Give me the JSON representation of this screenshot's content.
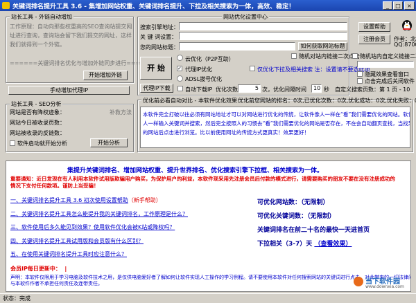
{
  "window": {
    "title": "关键词排名提升工具 3.6 - 集增加网站权重、关键词排名提升、下拉及相关搜索为一体，高效、稳定！"
  },
  "left_group": {
    "label": "站长工具 - 外链自动增加",
    "desc_lines": [
      "工作原理：自动向那些权重高的SEO查询站提交网",
      "址进行查询，查询站会留下我们提交的网址，这样",
      "我们就得到一个外链。"
    ],
    "divider": "======关键词排名优化与增加外链同步进行=====",
    "start_btn": "开始增加外链",
    "manual_btn": "手动增加代理IP"
  },
  "seo_group": {
    "label": "站长工具 - SEO分析",
    "rows": [
      "网站是否有降权迹象：",
      "网站今日被收录页数：",
      "网站被收录的反链数："
    ],
    "badge": "补救方法",
    "checkbox": "软件启动就开始分析",
    "analyze_btn": "开始分析"
  },
  "settings": {
    "label": "网站优化设置中心",
    "engine_label": "搜索引擎地址：",
    "keyword_label": "关 键 词设置：",
    "mysite_label": "您的网站标题：",
    "get_title_btn": "如何获取网站标题",
    "start_btn": "开 始",
    "cloud_opt": "云优化（P2P互助）",
    "proxy_opt": "代理IP优化",
    "adsl_opt": "ADSL拔号优化",
    "hint": "仅优化下拉及相关搜索 注：设置请不要选此项",
    "random_click": "随机对站内链接二次点击",
    "ip_btn": "代理IP下载",
    "auto_ip": "自动下载IP",
    "opt_count_label": "优化次数",
    "opt_count": "5",
    "times": "次",
    "interval_label": "，优化间隔时间",
    "interval": "10",
    "seconds": "秒"
  },
  "right_panel": {
    "help_btn": "设置帮助",
    "register_btn": "注册会员",
    "author_label": "作者：",
    "author_name": "北",
    "qq": "QQ:87000",
    "random_links": "随机站内自定义链接二次点击",
    "hide_effect": "隐藏效果查看窗口",
    "close_after": "点击完成后关闭软件",
    "search_pages": "自定义搜索页数：第 1 页 - 10"
  },
  "info": {
    "stats": "优化前您网站的排名：0次,已优化次数：0次,优化成功：0次,优化失败：0次",
    "section_label": "优化前必看自动对比 - 本软件优化效果",
    "desc_lines": [
      "本软件完全打破以往必须有网站地址才可以对网站进行优化的传统，让软件像人一样在“看”我们需要优化的网站。软件模拟",
      "人一样输入关键词并搜索，然后完全按照人的习惯去“看”我们需要优化的网站是否存在，不在会自动翻页查找，当找到",
      "的网站后点击进行浏览。比以前使用网址的传统方式更真实！效果更好！"
    ]
  },
  "main": {
    "headline": "集提升关键词排名、增加网站权重、提升世界排名、优化搜索引擎下拉框、相关搜索为一体。",
    "notice_lines": [
      "重要通知：近日发现在有人利用本软件试用版欺骗用户购买，为保护用户的利益，本软件现采用先注册会员后付款的模式进行，请需要购买的朋友不要在没有注册成功的",
      "情况下支付任何款项。谨防上当受骗！"
    ],
    "faq": [
      "一、关键词排名提升工具 3.6 初次使用设置帮助",
      "二、关键词排名提升工具怎么能提升我的关键词排名，工作原理是什么？",
      "三、软件使用后多久能见到效果？使用软件优化会被K站或降权吗？",
      "四、关键词排名提升工具试用版和会员版有什么区别？",
      "五、在使用关键词排名提升工具时应注意什么？"
    ],
    "faq_tag": "（新手帮助）",
    "right_lines": [
      "可优化网站数：（无限制）",
      "可优化关键词数：（无限制）",
      "关键词排名在前二十名的最快一天进首页",
      "下拉相关（3-7）天"
    ],
    "effect_link": "（查看效果）",
    "ip_update": "会员IP每日更新中：",
    "ip_mark": "|",
    "disclaimer_lines": [
      "声明：本软件仅限用于学习电脑及软件技术之用，是仅供电脑爱好者了解如何让软件实现人工操作的学习例程。请不要使用本软件对任何搜索网站的关键词进行点击，对此带来的一切法律问题",
      "与本软件作者不承担任何责任及连带责任。"
    ]
  },
  "status": {
    "text": "状态：完成"
  },
  "watermark": {
    "brand": "当下软件园",
    "url": "www.downxia.com"
  }
}
